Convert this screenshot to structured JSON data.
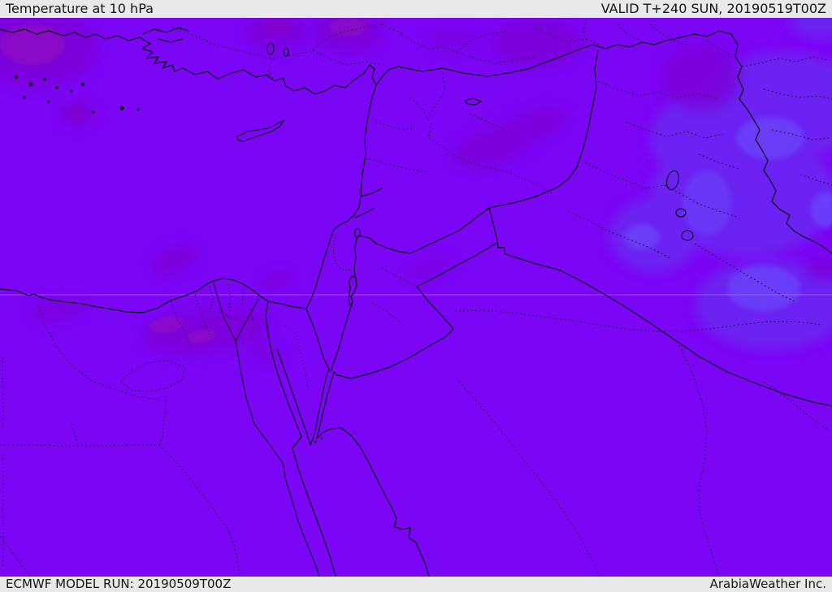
{
  "header": {
    "title": "Temperature at 10 hPa",
    "valid_label": "VALID T+240 SUN, 20190519T00Z"
  },
  "footer": {
    "model_run_label": "ECMWF MODEL RUN: 20190509T00Z",
    "attribution": "ArabiaWeather Inc."
  },
  "map": {
    "region": "Eastern Mediterranean / Middle East",
    "layer": "stratospheric temperature shading with country and admin boundaries",
    "colors": {
      "bar_bg": "#e9e9e9",
      "bar_text": "#151515",
      "base": "#7b05f5",
      "dark1": "#7d00d8",
      "dark2": "#8c08c2",
      "blue1": "#6b27f2",
      "blue2": "#6a41fa",
      "line": "#0d0014",
      "dashed": "#1a0a1e",
      "graticule": "#c77fd8"
    }
  }
}
